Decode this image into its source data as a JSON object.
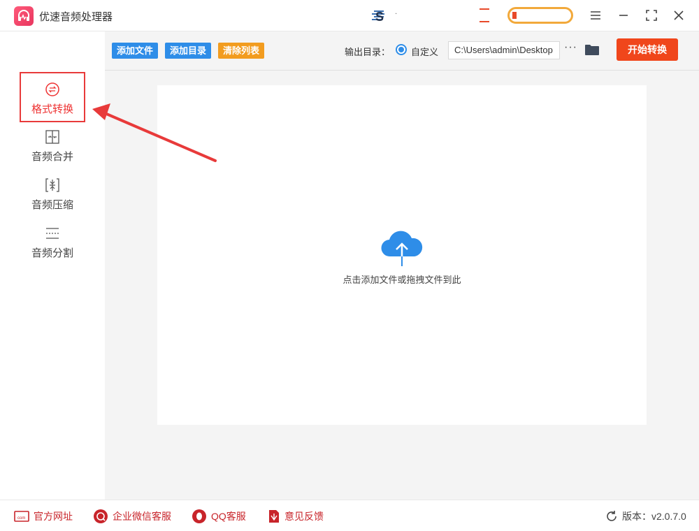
{
  "app": {
    "title": "优速音频处理器"
  },
  "titlebar": {
    "user_text": "‧"
  },
  "sidebar": {
    "items": [
      {
        "label": "格式转换",
        "icon": "format-convert-icon",
        "active": true
      },
      {
        "label": "音频合并",
        "icon": "merge-icon",
        "active": false
      },
      {
        "label": "音频压缩",
        "icon": "compress-icon",
        "active": false
      },
      {
        "label": "音频分割",
        "icon": "split-icon",
        "active": false
      }
    ]
  },
  "toolbar": {
    "add_file": "添加文件",
    "add_dir": "添加目录",
    "clear_list": "清除列表",
    "output_label": "输出目录：",
    "custom_label": "自定义",
    "output_path": "C:\\Users\\admin\\Desktop",
    "more": "···",
    "start": "开始转换"
  },
  "dropzone": {
    "hint": "点击添加文件或拖拽文件到此"
  },
  "footer": {
    "site": "官方网址",
    "wechat": "企业微信客服",
    "qq": "QQ客服",
    "feedback": "意见反馈",
    "version": "版本：v2.0.7.0"
  },
  "colors": {
    "accent_blue": "#2e8de8",
    "accent_orange": "#f29c1f",
    "start_red": "#f0461b",
    "footer_red": "#c8242a"
  }
}
